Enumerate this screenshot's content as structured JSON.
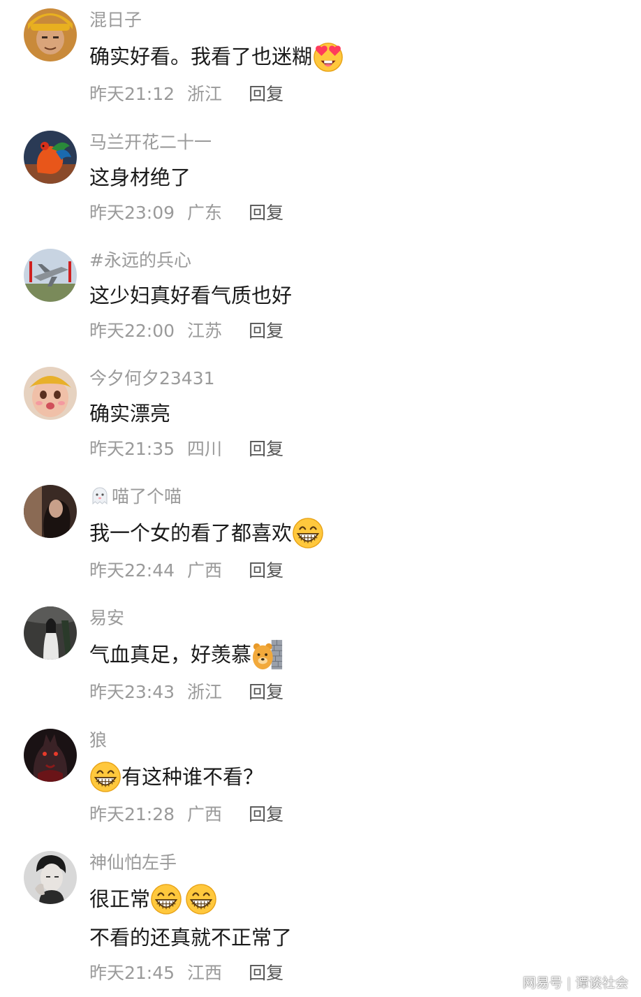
{
  "comments": [
    {
      "username": "混日子",
      "lines": [
        "确实好看。我看了也迷糊"
      ],
      "time": "昨天21:12",
      "location": "浙江",
      "reply": "回复",
      "emojis": [
        "heart-eyes-emoji"
      ]
    },
    {
      "username": "马兰开花二十一",
      "lines": [
        "这身材绝了"
      ],
      "time": "昨天23:09",
      "location": "广东",
      "reply": "回复"
    },
    {
      "username": "#永远的兵心",
      "lines": [
        "这少妇真好看气质也好"
      ],
      "time": "昨天22:00",
      "location": "江苏",
      "reply": "回复"
    },
    {
      "username": "今夕何夕23431",
      "lines": [
        "确实漂亮"
      ],
      "time": "昨天21:35",
      "location": "四川",
      "reply": "回复"
    },
    {
      "username": "喵了个喵",
      "lines": [
        "我一个女的看了都喜欢"
      ],
      "time": "昨天22:44",
      "location": "广西",
      "reply": "回复",
      "emojis": [
        "ghost-emoji",
        "grin-emoji"
      ]
    },
    {
      "username": "易安",
      "lines": [
        "气血真足，好羡慕"
      ],
      "time": "昨天23:43",
      "location": "浙江",
      "reply": "回复",
      "emojis": [
        "peeking-bear-emoji"
      ]
    },
    {
      "username": "狼",
      "lines": [
        "有这种谁不看？"
      ],
      "time": "昨天21:28",
      "location": "广西",
      "reply": "回复",
      "emojis": [
        "grin-emoji"
      ]
    },
    {
      "username": "神仙怕左手",
      "lines": [
        "很正常",
        "不看的还真就不正常了"
      ],
      "time": "昨天21:45",
      "location": "江西",
      "reply": "回复",
      "emojis": [
        "grin-emoji",
        "grin-emoji"
      ]
    }
  ],
  "watermark": {
    "brand": "网易号",
    "account": "谭谈社会"
  },
  "colors": {
    "username": "#9a9a9a",
    "text": "#1a1a1a",
    "meta": "#9a9a9a",
    "reply": "#555555"
  }
}
